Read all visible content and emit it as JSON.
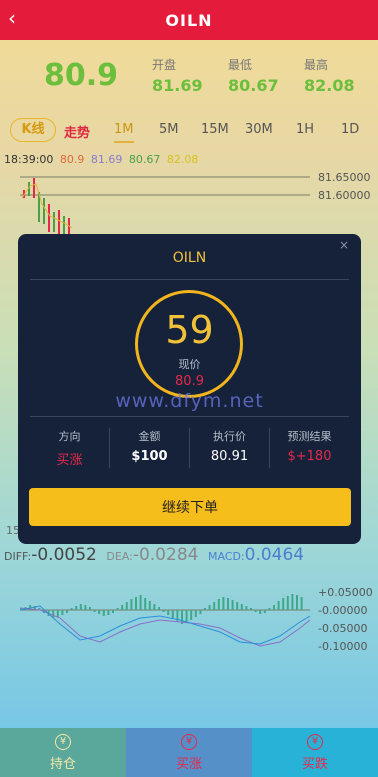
{
  "header": {
    "title": "OILN",
    "back_icon": "‹"
  },
  "quote": {
    "price": "80.9",
    "open_label": "开盘",
    "open": "81.69",
    "low_label": "最低",
    "low": "80.67",
    "high_label": "最高",
    "high": "82.08"
  },
  "tabs": {
    "kline": "K线",
    "trend": "走势",
    "periods": [
      "1M",
      "5M",
      "15M",
      "30M",
      "1H",
      "1D"
    ],
    "active": "1M"
  },
  "ohlc": {
    "time": "18:39:00",
    "o": "80.9",
    "h": "81.69",
    "l": "80.67",
    "c": "82.08"
  },
  "price_axis": [
    "81.65000",
    "81.60000",
    "15"
  ],
  "macd": {
    "diff_label": "DIFF:",
    "diff": "-0.0052",
    "dea_label": "DEA:",
    "dea": "-0.0284",
    "macd_label": "MACD:",
    "macd": "0.0464",
    "axis": [
      "+0.05000",
      "-0.00000",
      "-0.05000",
      "-0.10000"
    ]
  },
  "dialog": {
    "title": "OILN",
    "close": "×",
    "countdown": "59",
    "current_label": "现价",
    "current_value": "80.9",
    "watermark": "www.dfym.net",
    "direction_label": "方向",
    "direction": "买涨",
    "amount_label": "金额",
    "amount": "$100",
    "exec_label": "执行价",
    "exec_price": "80.91",
    "result_label": "预测结果",
    "result": "$+180",
    "continue": "继续下单"
  },
  "bottom": {
    "hold": "持仓",
    "buy_up": "买涨",
    "buy_down": "买跌"
  },
  "colors": {
    "topbar": "#e51b3b",
    "price": "#6bbf3c",
    "accent": "#f2c13a",
    "up": "#e5294a",
    "hold_bg": "#5aa79b",
    "up_bg": "#5590c9",
    "down_bg": "#28b2d8"
  }
}
